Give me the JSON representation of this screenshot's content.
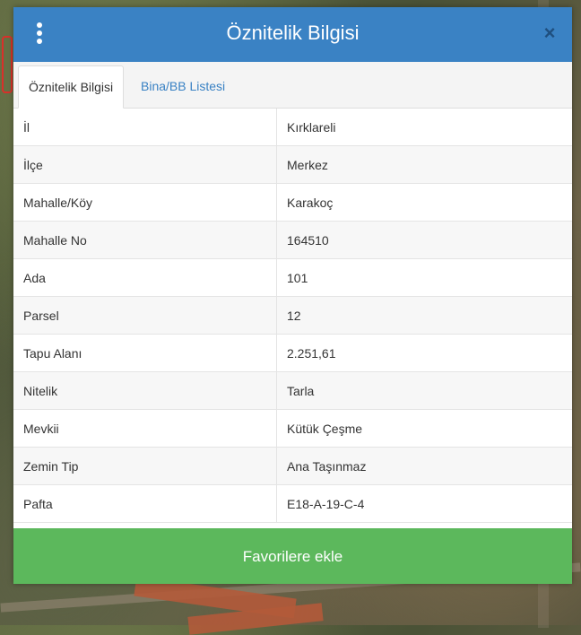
{
  "dialog": {
    "title": "Öznitelik Bilgisi",
    "close_icon": "×"
  },
  "tabs": [
    {
      "label": "Öznitelik Bilgisi",
      "active": true
    },
    {
      "label": "Bina/BB Listesi",
      "active": false
    }
  ],
  "attributes": [
    {
      "key": "İl",
      "value": "Kırklareli"
    },
    {
      "key": "İlçe",
      "value": "Merkez"
    },
    {
      "key": "Mahalle/Köy",
      "value": "Karakoç"
    },
    {
      "key": "Mahalle No",
      "value": "164510"
    },
    {
      "key": "Ada",
      "value": "101"
    },
    {
      "key": "Parsel",
      "value": "12"
    },
    {
      "key": "Tapu Alanı",
      "value": "2.251,61"
    },
    {
      "key": "Nitelik",
      "value": "Tarla"
    },
    {
      "key": "Mevkii",
      "value": "Kütük Çeşme"
    },
    {
      "key": "Zemin Tip",
      "value": "Ana Taşınmaz"
    },
    {
      "key": "Pafta",
      "value": "E18-A-19-C-4"
    }
  ],
  "actions": {
    "favorite_label": "Favorilere ekle"
  },
  "colors": {
    "header": "#3a82c4",
    "favorite_button": "#5cb85c",
    "tab_link": "#3a82c4"
  }
}
